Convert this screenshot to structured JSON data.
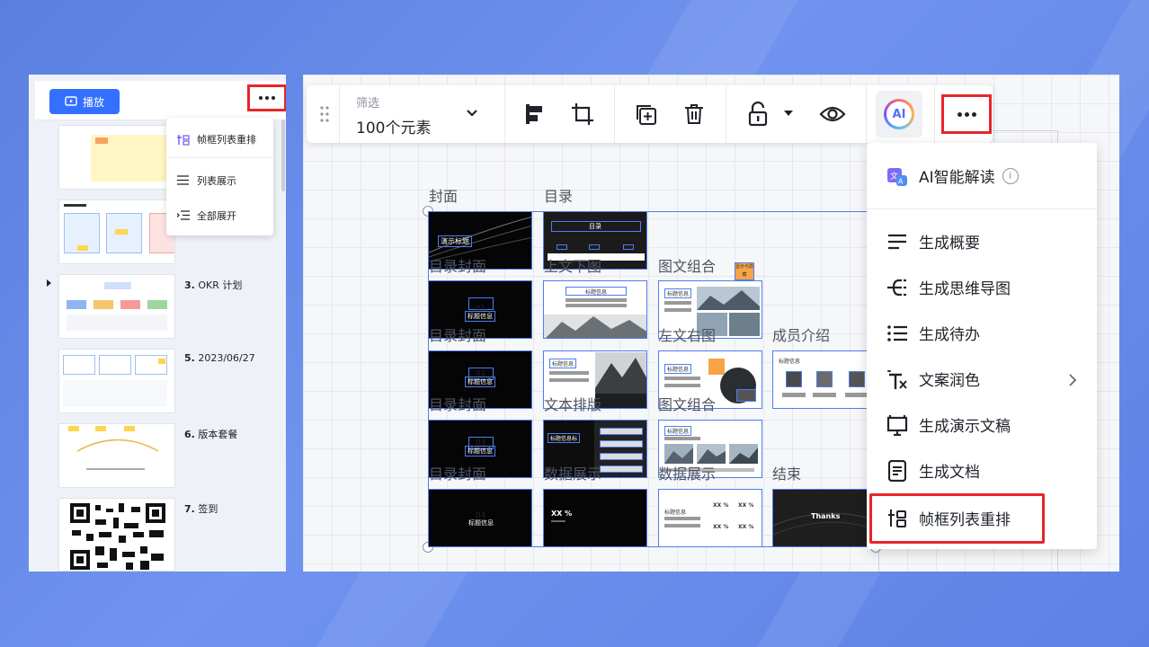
{
  "left_panel": {
    "play_label": "播放",
    "menu": {
      "items": [
        {
          "label": "帧框列表重排",
          "icon": "frame-sort-icon"
        },
        {
          "label": "列表展示",
          "icon": "list-icon"
        },
        {
          "label": "全部展开",
          "icon": "expand-all-icon"
        }
      ]
    },
    "thumbnails": [
      {
        "num": "",
        "title": ""
      },
      {
        "num": "",
        "title": ""
      },
      {
        "num": "3.",
        "title": "OKR 计划"
      },
      {
        "num": "5.",
        "title": "2023/06/27"
      },
      {
        "num": "6.",
        "title": "版本套餐"
      },
      {
        "num": "7.",
        "title": "签到"
      }
    ]
  },
  "toolbar": {
    "filter_label": "筛选",
    "filter_value": "100个元素",
    "ai_label": "AI"
  },
  "canvas": {
    "section_labels": [
      "封面",
      "目录",
      "目录封面",
      "上文下图",
      "图文组合",
      "目录封面",
      "左文右图",
      "成员介绍",
      "目录封面",
      "文本排版",
      "图文组合",
      "目录封面",
      "数据展示",
      "数据展示",
      "结束"
    ],
    "frame_texts": {
      "cover": "演示标题",
      "toc": "目录",
      "title": "标题信息",
      "title_alt": "标题信息标",
      "chapter_num": "01",
      "chapter_num2": "02",
      "chapter_num3": "03",
      "chapter_num4": "04",
      "data": "XX %",
      "thanks": "Thanks",
      "sticky": "显示与隐藏"
    }
  },
  "more_menu": {
    "ai_item": "AI智能解读",
    "items": [
      {
        "label": "生成概要",
        "icon": "summary-icon"
      },
      {
        "label": "生成思维导图",
        "icon": "mindmap-icon"
      },
      {
        "label": "生成待办",
        "icon": "todo-icon"
      },
      {
        "label": "文案润色",
        "icon": "text-polish-icon"
      },
      {
        "label": "生成演示文稿",
        "icon": "presentation-icon"
      },
      {
        "label": "生成文档",
        "icon": "document-icon"
      },
      {
        "label": "帧框列表重排",
        "icon": "frame-sort-icon"
      }
    ]
  }
}
